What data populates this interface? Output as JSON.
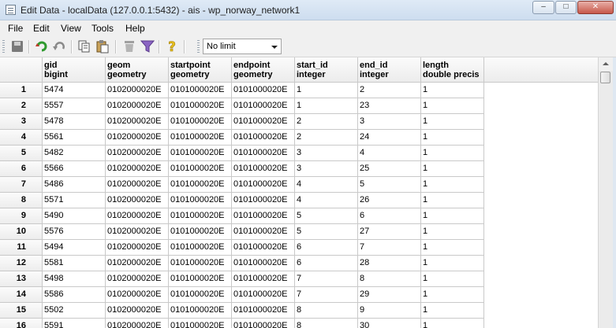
{
  "window": {
    "title": "Edit Data - localData (127.0.0.1:5432) - ais - wp_norway_network1",
    "minimize": "–",
    "maximize": "□",
    "close": "✕"
  },
  "menu": [
    "File",
    "Edit",
    "View",
    "Tools",
    "Help"
  ],
  "toolbar": {
    "icons": [
      "save-icon",
      "refresh-icon",
      "undo-icon",
      "copy-icon",
      "paste-icon",
      "delete-icon",
      "filter-icon",
      "help-icon"
    ],
    "limit_value": "No limit"
  },
  "colors": {
    "save": "#707070",
    "refresh": "#2f9a2f",
    "undo": "#8a8a8a",
    "filter": "#8b64c4",
    "help": "#e8c020",
    "delete": "#a0a0a0"
  },
  "grid": {
    "columns": [
      {
        "name": "gid",
        "type": "bigint"
      },
      {
        "name": "geom",
        "type": "geometry"
      },
      {
        "name": "startpoint",
        "type": "geometry"
      },
      {
        "name": "endpoint",
        "type": "geometry"
      },
      {
        "name": "start_id",
        "type": "integer"
      },
      {
        "name": "end_id",
        "type": "integer"
      },
      {
        "name": "length",
        "type": "double precis"
      }
    ],
    "rows": [
      {
        "n": "1",
        "cells": [
          "5474",
          "0102000020E",
          "0101000020E",
          "0101000020E",
          "1",
          "2",
          "1"
        ]
      },
      {
        "n": "2",
        "cells": [
          "5557",
          "0102000020E",
          "0101000020E",
          "0101000020E",
          "1",
          "23",
          "1"
        ]
      },
      {
        "n": "3",
        "cells": [
          "5478",
          "0102000020E",
          "0101000020E",
          "0101000020E",
          "2",
          "3",
          "1"
        ]
      },
      {
        "n": "4",
        "cells": [
          "5561",
          "0102000020E",
          "0101000020E",
          "0101000020E",
          "2",
          "24",
          "1"
        ]
      },
      {
        "n": "5",
        "cells": [
          "5482",
          "0102000020E",
          "0101000020E",
          "0101000020E",
          "3",
          "4",
          "1"
        ]
      },
      {
        "n": "6",
        "cells": [
          "5566",
          "0102000020E",
          "0101000020E",
          "0101000020E",
          "3",
          "25",
          "1"
        ]
      },
      {
        "n": "7",
        "cells": [
          "5486",
          "0102000020E",
          "0101000020E",
          "0101000020E",
          "4",
          "5",
          "1"
        ]
      },
      {
        "n": "8",
        "cells": [
          "5571",
          "0102000020E",
          "0101000020E",
          "0101000020E",
          "4",
          "26",
          "1"
        ]
      },
      {
        "n": "9",
        "cells": [
          "5490",
          "0102000020E",
          "0101000020E",
          "0101000020E",
          "5",
          "6",
          "1"
        ]
      },
      {
        "n": "10",
        "cells": [
          "5576",
          "0102000020E",
          "0101000020E",
          "0101000020E",
          "5",
          "27",
          "1"
        ]
      },
      {
        "n": "11",
        "cells": [
          "5494",
          "0102000020E",
          "0101000020E",
          "0101000020E",
          "6",
          "7",
          "1"
        ]
      },
      {
        "n": "12",
        "cells": [
          "5581",
          "0102000020E",
          "0101000020E",
          "0101000020E",
          "6",
          "28",
          "1"
        ]
      },
      {
        "n": "13",
        "cells": [
          "5498",
          "0102000020E",
          "0101000020E",
          "0101000020E",
          "7",
          "8",
          "1"
        ]
      },
      {
        "n": "14",
        "cells": [
          "5586",
          "0102000020E",
          "0101000020E",
          "0101000020E",
          "7",
          "29",
          "1"
        ]
      },
      {
        "n": "15",
        "cells": [
          "5502",
          "0102000020E",
          "0101000020E",
          "0101000020E",
          "8",
          "9",
          "1"
        ]
      },
      {
        "n": "16",
        "cells": [
          "5591",
          "0102000020E",
          "0101000020E",
          "0101000020E",
          "8",
          "30",
          "1"
        ]
      }
    ]
  }
}
